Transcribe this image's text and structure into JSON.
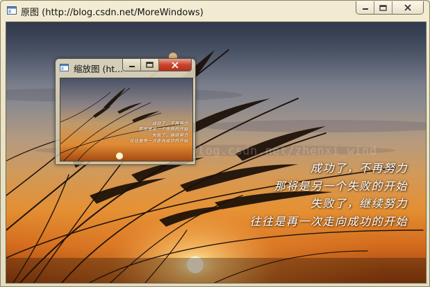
{
  "main_window": {
    "title": "原图 (http://blog.csdn.net/MoreWindows)",
    "buttons": [
      "minimize",
      "maximize",
      "close"
    ]
  },
  "zoom_window": {
    "title": "缩放图 (ht..."
  },
  "poem": {
    "lines": [
      "成功了，不再努力",
      "那将是另一个失败的开始",
      "失败了，继续努力",
      "往往是再一次走向成功的开始"
    ]
  },
  "watermark": "http://blog.csdn.net/zhenxi_wind",
  "icons": {
    "app": "window-app-icon",
    "minimize": "minimize-icon",
    "maximize": "maximize-icon",
    "close": "close-icon"
  },
  "colors": {
    "frame": "#ece3c7",
    "close_red": "#c9442c",
    "sky_top": "#4b5568",
    "sunset_orange": "#e89a3a",
    "sun": "#fff6c8"
  }
}
